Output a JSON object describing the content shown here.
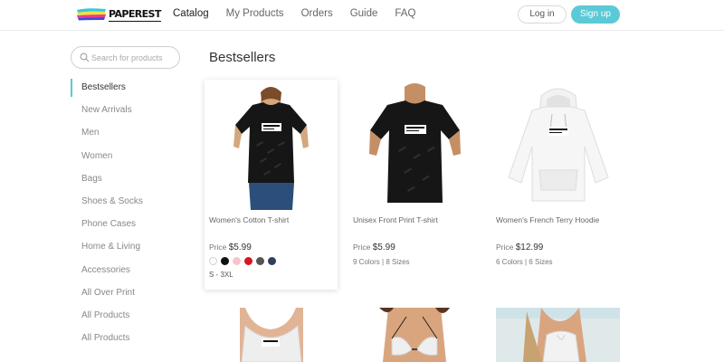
{
  "header": {
    "logo_text": "PAPEREST",
    "nav": [
      {
        "label": "Catalog",
        "active": true
      },
      {
        "label": "My Products",
        "active": false
      },
      {
        "label": "Orders",
        "active": false
      },
      {
        "label": "Guide",
        "active": false
      },
      {
        "label": "FAQ",
        "active": false
      }
    ],
    "login_label": "Log in",
    "signup_label": "Sign up",
    "accent_color": "#5bc9d6"
  },
  "search": {
    "placeholder": "Search for products",
    "icon": "search-icon"
  },
  "sidebar": {
    "items": [
      {
        "label": "Bestsellers",
        "active": true
      },
      {
        "label": "New Arrivals",
        "active": false
      },
      {
        "label": "Men",
        "active": false
      },
      {
        "label": "Women",
        "active": false
      },
      {
        "label": "Bags",
        "active": false
      },
      {
        "label": "Shoes & Socks",
        "active": false
      },
      {
        "label": "Phone Cases",
        "active": false
      },
      {
        "label": "Home & Living",
        "active": false
      },
      {
        "label": "Accessories",
        "active": false
      },
      {
        "label": "All Over Print",
        "active": false
      },
      {
        "label": "All Products",
        "active": false
      },
      {
        "label": "All Products",
        "active": false
      }
    ]
  },
  "main": {
    "title": "Bestsellers",
    "products": [
      {
        "name": "Women's Cotton T-shirt",
        "price_label": "Price",
        "price": "$5.99",
        "colors": [
          "#ffffff",
          "#111111",
          "#f4c6cc",
          "#d8161f",
          "#555555",
          "#2f3f5c"
        ],
        "sizes": "S - 3XL"
      },
      {
        "name": "Unisex Front Print T-shirt",
        "price_label": "Price",
        "price": "$5.99",
        "meta": "9 Colors  |  8 Sizes"
      },
      {
        "name": "Women's French Terry Hoodie",
        "price_label": "Price",
        "price": "$12.99",
        "meta": "6 Colors  |  6 Sizes"
      }
    ]
  }
}
